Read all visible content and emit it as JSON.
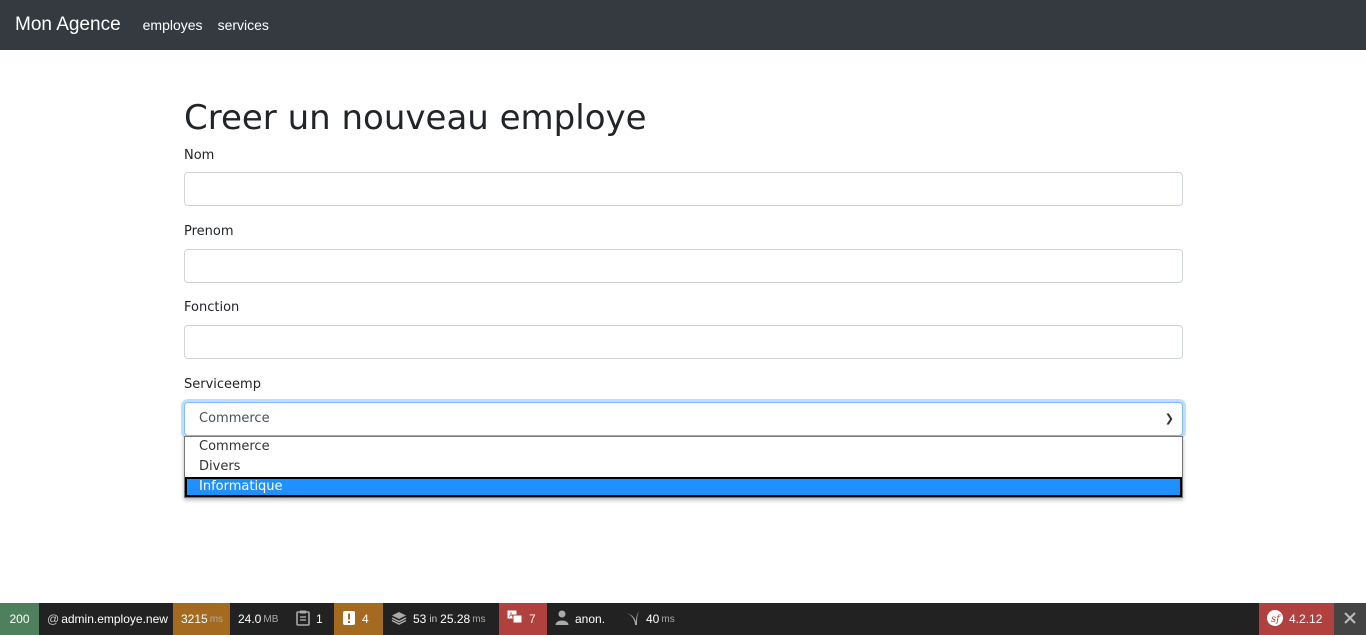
{
  "navbar": {
    "brand": "Mon Agence",
    "links": [
      "employes",
      "services"
    ]
  },
  "page": {
    "title": "Creer un nouveau employe"
  },
  "form": {
    "nom_label": "Nom",
    "prenom_label": "Prenom",
    "fonction_label": "Fonction",
    "service_label": "Serviceemp",
    "service_selected": "Commerce",
    "service_options": [
      "Commerce",
      "Divers",
      "Informatique"
    ],
    "highlighted_option": "Informatique"
  },
  "toolbar": {
    "status": "200",
    "route": "admin.employe.new",
    "time_value": "3215",
    "time_unit": "ms",
    "memory_value": "24.0",
    "memory_unit": "MB",
    "forms_count": "1",
    "logs_count": "4",
    "db_queries": "53",
    "db_in": "in",
    "db_time": "25.28",
    "db_unit": "ms",
    "translation_count": "7",
    "user": "anon.",
    "twig_time": "40",
    "twig_unit": "ms",
    "version": "4.2.12",
    "colors": {
      "status_bg": "#4f805d",
      "time_bg": "#a46a1f",
      "logs_bg": "#a46a1f",
      "translation_bg": "#b0413e",
      "version_bg": "#b0413e"
    }
  }
}
